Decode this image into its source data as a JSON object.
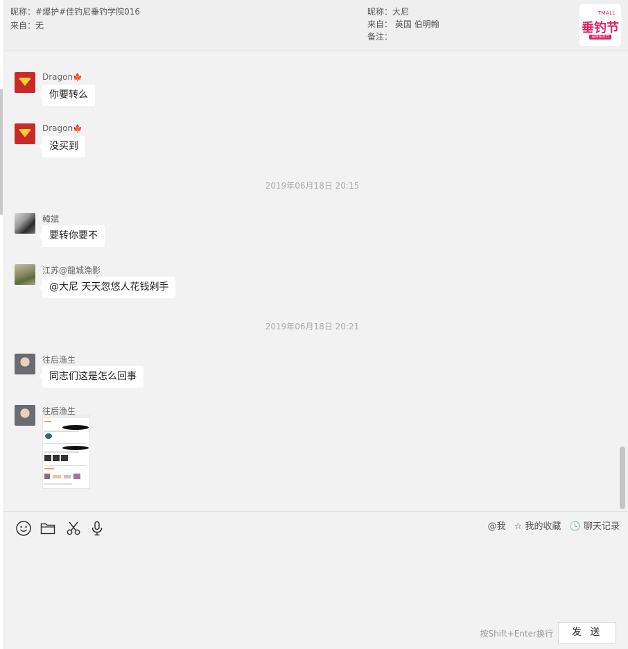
{
  "header": {
    "left_nickname_label": "昵称：",
    "left_nickname": "#爆护#佳钓尼垂钓学院016",
    "left_from_label": "来自：",
    "left_from": "无",
    "right_nickname_label": "昵称：",
    "right_nickname": "大尼",
    "right_from_label": "来自：",
    "right_from": "英国 伯明翰",
    "right_note_label": "备注：",
    "logo": {
      "tmall": "TMALL",
      "main": "垂钓节",
      "sub": "品类狂欢日"
    }
  },
  "messages": [
    {
      "sender": "Dragon",
      "emoji": "🍁",
      "text": "你要转么"
    },
    {
      "sender": "Dragon",
      "emoji": "🍁",
      "text": "没买到"
    },
    {
      "timestamp": "2019年06月18日 20:15"
    },
    {
      "sender": "韓斌",
      "text": "要转你要不"
    },
    {
      "sender": "江苏@龍城漁影",
      "text": "@大尼 天天忽悠人花钱剁手"
    },
    {
      "timestamp": "2019年06月18日 20:21"
    },
    {
      "sender": "往后渔生",
      "text": "同志们这是怎么回事"
    },
    {
      "sender": "往后渔生",
      "image": "screenshot-thumbnail"
    }
  ],
  "toolbar": {
    "icons": [
      "emoji-icon",
      "folder-icon",
      "scissors-icon",
      "microphone-icon"
    ],
    "at_me": "@我",
    "favorites": "我的收藏",
    "history": "聊天记录"
  },
  "input": {
    "hint": "按Shift+Enter换行",
    "send_label": "发 送"
  },
  "colors": {
    "background": "#f2f2f2",
    "bubble": "#ffffff",
    "logo_accent": "#e1205f"
  }
}
